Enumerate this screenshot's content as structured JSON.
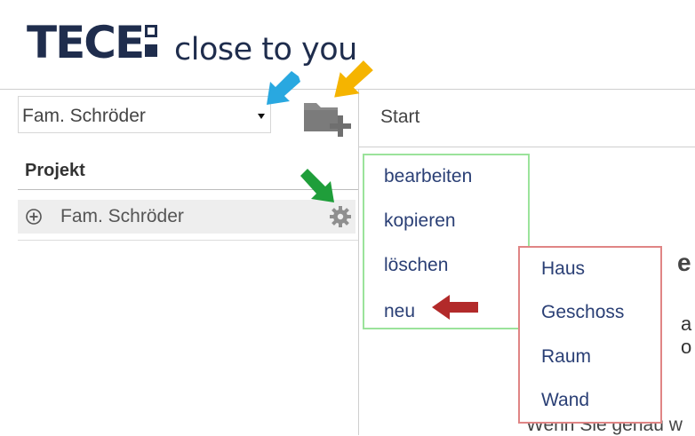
{
  "brand": {
    "wordmark": "TECE",
    "tagline": "close to you"
  },
  "sidebar": {
    "project_select": {
      "value": "Fam. Schröder"
    },
    "section_title": "Projekt",
    "tree": [
      {
        "label": "Fam. Schröder",
        "expand_icon": "plus-circle-icon",
        "action_icon": "gear-icon"
      }
    ],
    "add_folder_icon": "folder-add-icon"
  },
  "main": {
    "breadcrumb": "Start",
    "context_menu": {
      "items": [
        "bearbeiten",
        "kopieren",
        "löschen",
        "neu"
      ]
    },
    "submenu": {
      "items": [
        "Haus",
        "Geschoss",
        "Raum",
        "Wand"
      ]
    },
    "partial_text": {
      "heading_fragment": "e",
      "line_a": "a",
      "line_b": "o",
      "footer_fragment": "Wenn Sie genau w"
    }
  },
  "annotations": {
    "blue_arrow_color": "#29a8e0",
    "orange_arrow_color": "#f5b400",
    "green_arrow_color": "#1f9e3a",
    "red_arrow_color": "#b22a2a",
    "context_menu_border": "#9be39b",
    "submenu_border": "#e08585"
  }
}
